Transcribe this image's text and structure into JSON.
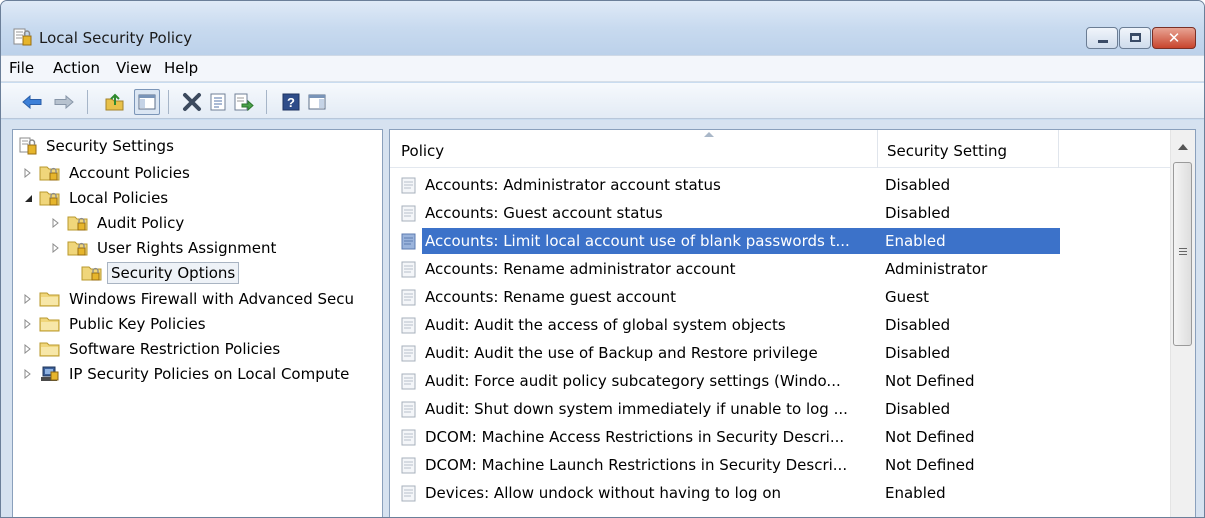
{
  "window": {
    "title": "Local Security Policy"
  },
  "menu": [
    "File",
    "Action",
    "View",
    "Help"
  ],
  "toolbar": {
    "buttons": [
      "back-arrow-icon",
      "forward-arrow-icon",
      "up-folder-icon",
      "show-hide-tree-icon",
      "delete-icon",
      "properties-icon",
      "export-list-icon",
      "help-icon",
      "show-hide-action-pane-icon"
    ]
  },
  "tree": {
    "root": "Security Settings",
    "items": [
      {
        "label": "Account Policies",
        "expanded": false
      },
      {
        "label": "Local Policies",
        "expanded": true
      },
      {
        "label": "Audit Policy",
        "expanded": false
      },
      {
        "label": "User Rights Assignment",
        "expanded": false
      },
      {
        "label": "Security Options",
        "selected": true
      },
      {
        "label": "Windows Firewall with Advanced Secu",
        "expanded": false
      },
      {
        "label": "Public Key Policies",
        "expanded": false
      },
      {
        "label": "Software Restriction Policies",
        "expanded": false
      },
      {
        "label": "IP Security Policies on Local Compute",
        "expanded": false
      }
    ]
  },
  "list": {
    "columns": [
      "Policy",
      "Security Setting"
    ],
    "rows": [
      {
        "policy": "Accounts: Administrator account status",
        "setting": "Disabled"
      },
      {
        "policy": "Accounts: Guest account status",
        "setting": "Disabled"
      },
      {
        "policy": "Accounts: Limit local account use of blank passwords t...",
        "setting": "Enabled",
        "selected": true
      },
      {
        "policy": "Accounts: Rename administrator account",
        "setting": "Administrator"
      },
      {
        "policy": "Accounts: Rename guest account",
        "setting": "Guest"
      },
      {
        "policy": "Audit: Audit the access of global system objects",
        "setting": "Disabled"
      },
      {
        "policy": "Audit: Audit the use of Backup and Restore privilege",
        "setting": "Disabled"
      },
      {
        "policy": "Audit: Force audit policy subcategory settings (Windo...",
        "setting": "Not Defined"
      },
      {
        "policy": "Audit: Shut down system immediately if unable to log ...",
        "setting": "Disabled"
      },
      {
        "policy": "DCOM: Machine Access Restrictions in Security Descri...",
        "setting": "Not Defined"
      },
      {
        "policy": "DCOM: Machine Launch Restrictions in Security Descri...",
        "setting": "Not Defined"
      },
      {
        "policy": "Devices: Allow undock without having to log on",
        "setting": "Enabled"
      }
    ]
  },
  "colors": {
    "selection": "#3c72c9",
    "titlebar": "#c8daef"
  }
}
